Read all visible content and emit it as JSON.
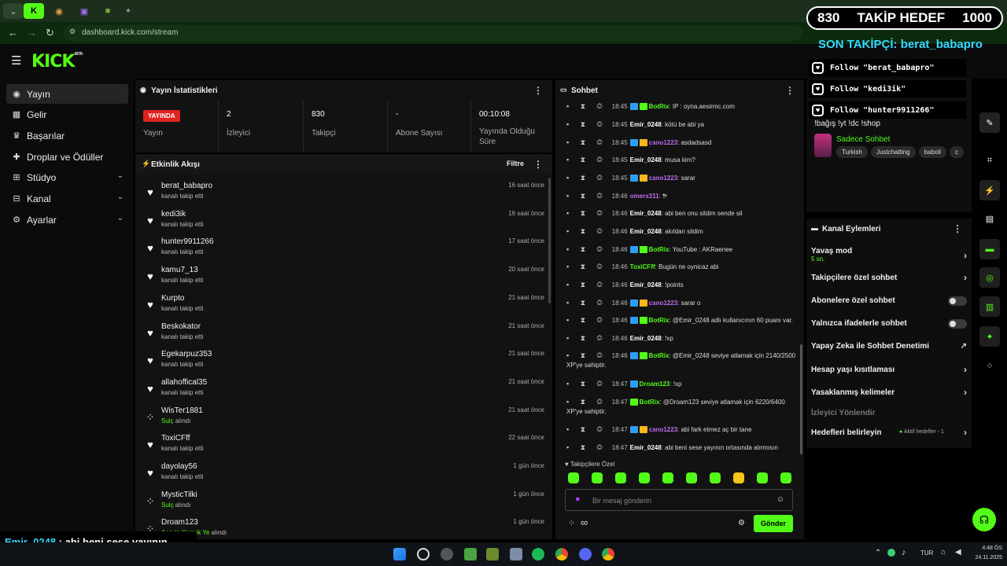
{
  "browser": {
    "url": "dashboard.kick.com/stream",
    "new_tab": "+"
  },
  "header": {
    "logo": "KICK",
    "logo_sup": "BETA"
  },
  "sidebar": {
    "items": [
      {
        "label": "Yayın"
      },
      {
        "label": "Gelir"
      },
      {
        "label": "Başarılar"
      },
      {
        "label": "Droplar ve Ödüller"
      },
      {
        "label": "Stüdyo"
      },
      {
        "label": "Kanal"
      },
      {
        "label": "Ayarlar"
      }
    ]
  },
  "stats": {
    "title": "Yayın İstatistikleri",
    "live_badge": "YAYINDA",
    "live_label": "Yayın",
    "viewers_value": "2",
    "viewers_label": "İzleyici",
    "followers_value": "830",
    "followers_label": "Takipçi",
    "subs_value": "-",
    "subs_label": "Abone Sayısı",
    "duration_value": "00:10:08",
    "duration_label": "Yayında Olduğu Süre"
  },
  "activity": {
    "title": "Etkinlik Akışı",
    "filter": "Filtre",
    "items": [
      {
        "name": "berat_babapro",
        "desc": "kanalı takip etti",
        "time": "16 saat önce",
        "type": "follow"
      },
      {
        "name": "kedi3ik",
        "desc": "kanalı takip etti",
        "time": "16 saat önce",
        "type": "follow"
      },
      {
        "name": "hunter9911266",
        "desc": "kanalı takip etti",
        "time": "17 saat önce",
        "type": "follow"
      },
      {
        "name": "kamu7_13",
        "desc": "kanalı takip etti",
        "time": "20 saat önce",
        "type": "follow"
      },
      {
        "name": "Kurpto",
        "desc": "kanalı takip etti",
        "time": "21 saat önce",
        "type": "follow"
      },
      {
        "name": "Beskokator",
        "desc": "kanalı takip etti",
        "time": "21 saat önce",
        "type": "follow"
      },
      {
        "name": "Egekarpuz353",
        "desc": "kanalı takip etti",
        "time": "21 saat önce",
        "type": "follow"
      },
      {
        "name": "allahoffical35",
        "desc": "kanalı takip etti",
        "time": "21 saat önce",
        "type": "follow"
      },
      {
        "name": "WisTer1881",
        "desc_highlight": "Sulç",
        "desc": " alındı",
        "time": "21 saat önce",
        "type": "reward"
      },
      {
        "name": "ToxiCFff",
        "desc": "kanalı takip etti",
        "time": "22 saat önce",
        "type": "follow"
      },
      {
        "name": "dayolay56",
        "desc": "kanalı takip etti",
        "time": "1 gün önce",
        "type": "follow"
      },
      {
        "name": "MysticTilki",
        "desc_highlight": "Sulç",
        "desc": " alındı",
        "time": "1 gün önce",
        "type": "reward"
      },
      {
        "name": "Droam123",
        "desc_highlight": "Acayip Yemek Ye",
        "desc": " alındı",
        "time": "1 gün önce",
        "type": "reward"
      }
    ]
  },
  "chat": {
    "title": "Sohbet",
    "messages": [
      {
        "time": "18:45",
        "user": "BotRix",
        "color": "#53fc18",
        "text": ": IP : oyna.aesirmc.com",
        "badges": [
          "#2f9df4",
          "#53fc18"
        ]
      },
      {
        "time": "18:45",
        "user": "Emir_0248",
        "color": "#ffffff",
        "text": ": kötü be abi ya",
        "badges": []
      },
      {
        "time": "18:45",
        "user": "cano1223",
        "color": "#c16cf0",
        "text": ": asdadsasd",
        "badges": [
          "#2f9df4",
          "#f5b71b"
        ]
      },
      {
        "time": "18:45",
        "user": "Emir_0248",
        "color": "#ffffff",
        "text": ": musa kim?",
        "badges": []
      },
      {
        "time": "18:45",
        "user": "cano1223",
        "color": "#c16cf0",
        "text": ": sarar",
        "badges": [
          "#2f9df4",
          "#f5b71b"
        ]
      },
      {
        "time": "18:46",
        "user": "omerx311",
        "color": "#c16cf0",
        "text": ": ⛈",
        "badges": []
      },
      {
        "time": "18:46",
        "user": "Emir_0248",
        "color": "#ffffff",
        "text": ": abi ben onu sildim sende sil",
        "badges": []
      },
      {
        "time": "18:46",
        "user": "Emir_0248",
        "color": "#ffffff",
        "text": ": akıldan sildim",
        "badges": []
      },
      {
        "time": "18:46",
        "user": "BotRix",
        "color": "#53fc18",
        "text": ": YouTube : AKRaenee",
        "badges": [
          "#2f9df4",
          "#53fc18"
        ]
      },
      {
        "time": "18:46",
        "user": "ToxiCFff",
        "color": "#53fc18",
        "text": ": Bugün ne oynicaz abi",
        "badges": []
      },
      {
        "time": "18:46",
        "user": "Emir_0248",
        "color": "#ffffff",
        "text": ": !points",
        "badges": []
      },
      {
        "time": "18:46",
        "user": "cano1223",
        "color": "#c16cf0",
        "text": ": sarar o",
        "badges": [
          "#2f9df4",
          "#f5b71b"
        ]
      },
      {
        "time": "18:46",
        "user": "BotRix",
        "color": "#53fc18",
        "text": ": @Emir_0248 adlı kullanıcının 60 puanı var.",
        "badges": [
          "#2f9df4",
          "#53fc18"
        ]
      },
      {
        "time": "18:46",
        "user": "Emir_0248",
        "color": "#ffffff",
        "text": ": !xp",
        "badges": []
      },
      {
        "time": "18:46",
        "user": "BotRix",
        "color": "#53fc18",
        "text": ": @Emir_0248 seviye atlamak için 2140/2500 XP'ye sahiptir.",
        "badges": [
          "#2f9df4",
          "#53fc18"
        ]
      },
      {
        "time": "18:47",
        "user": "Droam123",
        "color": "#53fc18",
        "text": ": !xp",
        "badges": [
          "#2f9df4"
        ]
      },
      {
        "time": "18:47",
        "user": "BotRix",
        "color": "#53fc18",
        "text": ": @Droam123 seviye atlamak için 6220/6400 XP'ye sahiptir.",
        "badges": [
          "#53fc18"
        ]
      },
      {
        "time": "18:47",
        "user": "cano1223",
        "color": "#c16cf0",
        "text": ": abi fark etmez aç bir tane",
        "badges": [
          "#2f9df4",
          "#f5b71b"
        ]
      },
      {
        "time": "18:47",
        "user": "Emir_0248",
        "color": "#ffffff",
        "text": ": abi beni sese yayının ortasında alırmısın",
        "badges": []
      }
    ],
    "followers_only": "Takipçilere Özel",
    "input_placeholder": "Bir mesaj gönderin",
    "send": "Gönder",
    "infinity": "∞"
  },
  "channel_info": {
    "tags_text": "!bağış !yt !dc !shop",
    "subtitle": "Sadece Sohbet",
    "tags": [
      "Turkish",
      "Justchatting",
      "baboli",
      "c"
    ]
  },
  "channel_actions": {
    "title": "Kanal Eylemleri",
    "slow_mode": "Yavaş mod",
    "slow_mode_value": "5 sn.",
    "followers_chat": "Takipçilere özel sohbet",
    "subs_chat": "Abonelere özel sohbet",
    "emotes_chat": "Yalnızca ifadelerle sohbet",
    "ai_moderation": "Yapay Zeka ile Sohbet Denetimi",
    "age_restriction": "Hesap yaşı kısıtlaması",
    "banned_words": "Yasaklanmış kelimeler",
    "redirect": "İzleyici Yönlendir",
    "goals": "Hedefleri belirleyin",
    "goals_status": "Aktif hedefler - 1"
  },
  "overlay": {
    "goal_current": "830",
    "goal_label": "TAKİP HEDEF",
    "goal_target": "1000",
    "last_follower": "SON TAKİPÇİ: berat_babapro",
    "follows": [
      "Follow \"berat_babapro\"",
      "Follow \"kedi3ik\"",
      "Follow \"hunter9911266\""
    ],
    "caption_user": "Emir_0248",
    "caption_text": " : abi beni sese yayının ortasında alırmısın"
  },
  "taskbar": {
    "lang": "TUR",
    "time": "4:48 ÖS",
    "date": "24.11.2025"
  },
  "colors": {
    "accent": "#53fc18",
    "live": "#e0221e"
  }
}
